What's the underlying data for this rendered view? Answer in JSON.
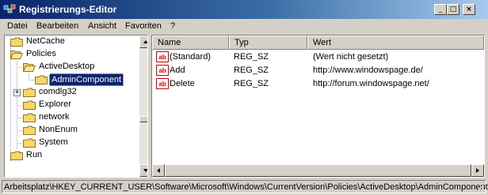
{
  "window": {
    "title": "Registrierungs-Editor",
    "controls": {
      "minimize": "_",
      "maximize": "□",
      "close": "×"
    }
  },
  "menu": [
    "Datei",
    "Bearbeiten",
    "Ansicht",
    "Favoriten",
    "?"
  ],
  "tree": {
    "items": [
      {
        "label": "NetCache"
      },
      {
        "label": "Policies"
      },
      {
        "label": "ActiveDesktop"
      },
      {
        "label": "AdminComponent",
        "selected": true
      },
      {
        "label": "comdlg32",
        "expander": "+"
      },
      {
        "label": "Explorer"
      },
      {
        "label": "network"
      },
      {
        "label": "NonEnum"
      },
      {
        "label": "System"
      },
      {
        "label": "Run"
      }
    ]
  },
  "list": {
    "headers": [
      "Name",
      "Typ",
      "Wert"
    ],
    "rows": [
      {
        "name": "(Standard)",
        "type": "REG_SZ",
        "value": "(Wert nicht gesetzt)",
        "icon": "string-value-icon"
      },
      {
        "name": "Add",
        "type": "REG_SZ",
        "value": "http://www.windowspage.de/",
        "icon": "string-value-icon"
      },
      {
        "name": "Delete",
        "type": "REG_SZ",
        "value": "http://forum.windowspage.net/",
        "icon": "string-value-icon"
      }
    ]
  },
  "status": {
    "path": "Arbeitsplatz\\HKEY_CURRENT_USER\\Software\\Microsoft\\Windows\\CurrentVersion\\Policies\\ActiveDesktop\\AdminComponent"
  },
  "colors": {
    "title_start": "#0a246a",
    "title_end": "#a6caf0",
    "selection": "#0a246a",
    "folder": "#f8d66a",
    "icon_red": "#cc0000"
  }
}
